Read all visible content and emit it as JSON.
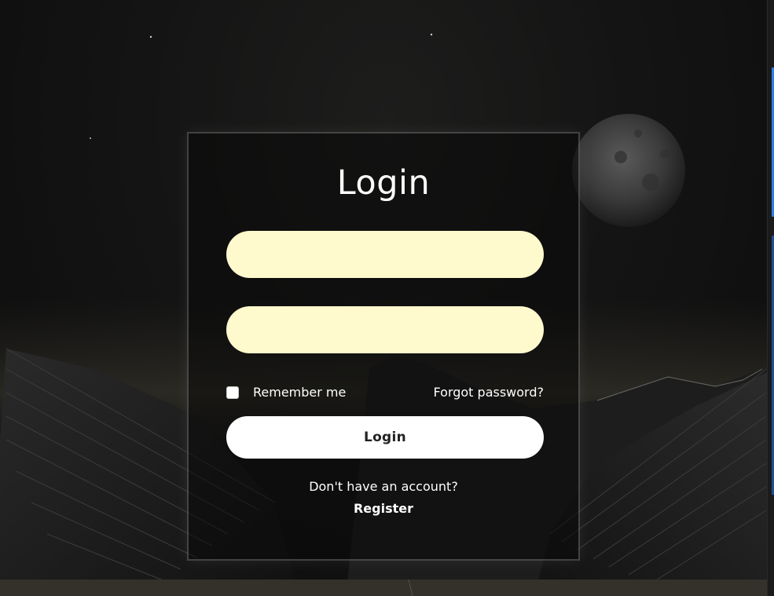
{
  "login": {
    "title": "Login",
    "username_placeholder": "",
    "password_placeholder": "",
    "remember_label": "Remember me",
    "forgot_label": "Forgot password?",
    "submit_label": "Login",
    "register_prompt": "Don't have an account?",
    "register_label": "Register"
  },
  "colors": {
    "input_background": "#fffacd",
    "button_background": "#ffffff",
    "text": "#ffffff",
    "page_background": "#121212"
  },
  "icons": {
    "remember": "checkbox-icon"
  }
}
